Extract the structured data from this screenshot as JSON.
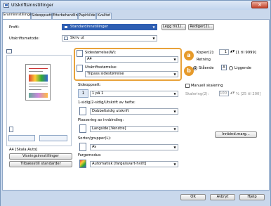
{
  "title": "Utskriftsinnstillinger",
  "close_glyph": "✕",
  "tabs": [
    {
      "label": "Grunninnstillinger"
    },
    {
      "label": "Sideoppsett"
    },
    {
      "label": "Etterbehandling"
    },
    {
      "label": "Papirkilde"
    },
    {
      "label": "Kvalitet"
    }
  ],
  "profile": {
    "label": "Profil:",
    "value": "Standardinnstillinger",
    "add_label": "Legg til(1)...",
    "edit_label": "Rediger(2)..."
  },
  "output": {
    "label": "Utskriftsmetode:",
    "value": "Skriv ut"
  },
  "preview": {
    "caption": "A4 [Skala:Auto]"
  },
  "left_buttons": {
    "view_settings": "Visningsinnstillinger",
    "restore": "Tilbakestill standarder"
  },
  "page_size": {
    "label": "Sidestørrelse(W):",
    "value": "A4"
  },
  "output_size": {
    "label": "Utskriftsstørrelse:",
    "value": "Tilpass sidestørrelse"
  },
  "copies": {
    "label": "Kopier(2):",
    "value": "1",
    "range": "[1 til 9999]"
  },
  "orientation": {
    "label": "Retning",
    "portrait": "Stående",
    "landscape": "Liggende"
  },
  "badges": [
    "a",
    "b"
  ],
  "manual_scaling": {
    "label": "Manuell skalering",
    "scaling_label": "Skalering(2):",
    "value": "100",
    "range": "% [25 til 200]"
  },
  "layout": {
    "label": "Sideoppsett:",
    "value": "1 på 1",
    "icon_text": "1"
  },
  "duplex": {
    "label": "1-sidig/2-sidig/Utskrift av hefte:",
    "value": "Dobbeltsidig utskrift"
  },
  "binding": {
    "label": "Plassering av innbinding:",
    "value": "Langside [Venstre]",
    "margin_button": "Innbind.marg..."
  },
  "sort": {
    "label": "Sorter/grupper(L):",
    "value": "Av"
  },
  "color": {
    "label": "Fargemodus:",
    "value": "Automatisk [farge/svart-hvitt]"
  },
  "footer": {
    "ok": "OK",
    "cancel": "Avbryt",
    "help": "Hjelp"
  }
}
